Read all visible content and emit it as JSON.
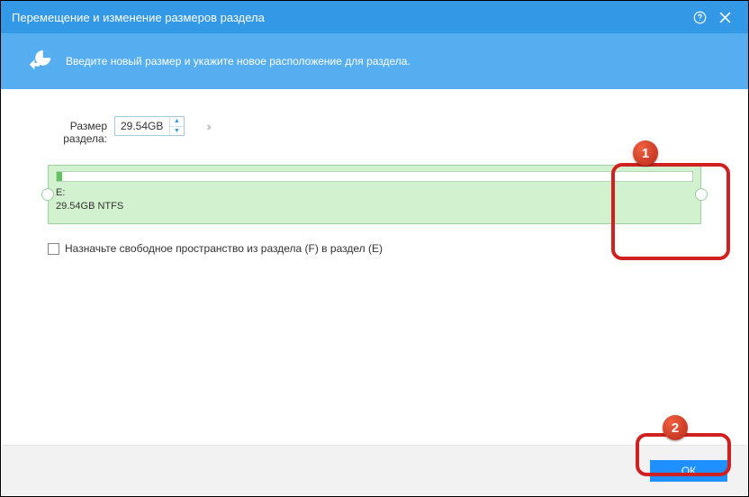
{
  "titlebar": {
    "title": "Перемещение и изменение размеров раздела"
  },
  "banner": {
    "text": "Введите новый размер и укажите новое расположение для раздела."
  },
  "size": {
    "label": "Размер раздела:",
    "value": "29.54GB"
  },
  "partition": {
    "drive": "E:",
    "info": "29.54GB NTFS"
  },
  "checkbox": {
    "label": "Назначьте свободное пространство из раздела (F) в раздел (E)"
  },
  "footer": {
    "ok": "ОК"
  },
  "callouts": {
    "one": "1",
    "two": "2"
  }
}
